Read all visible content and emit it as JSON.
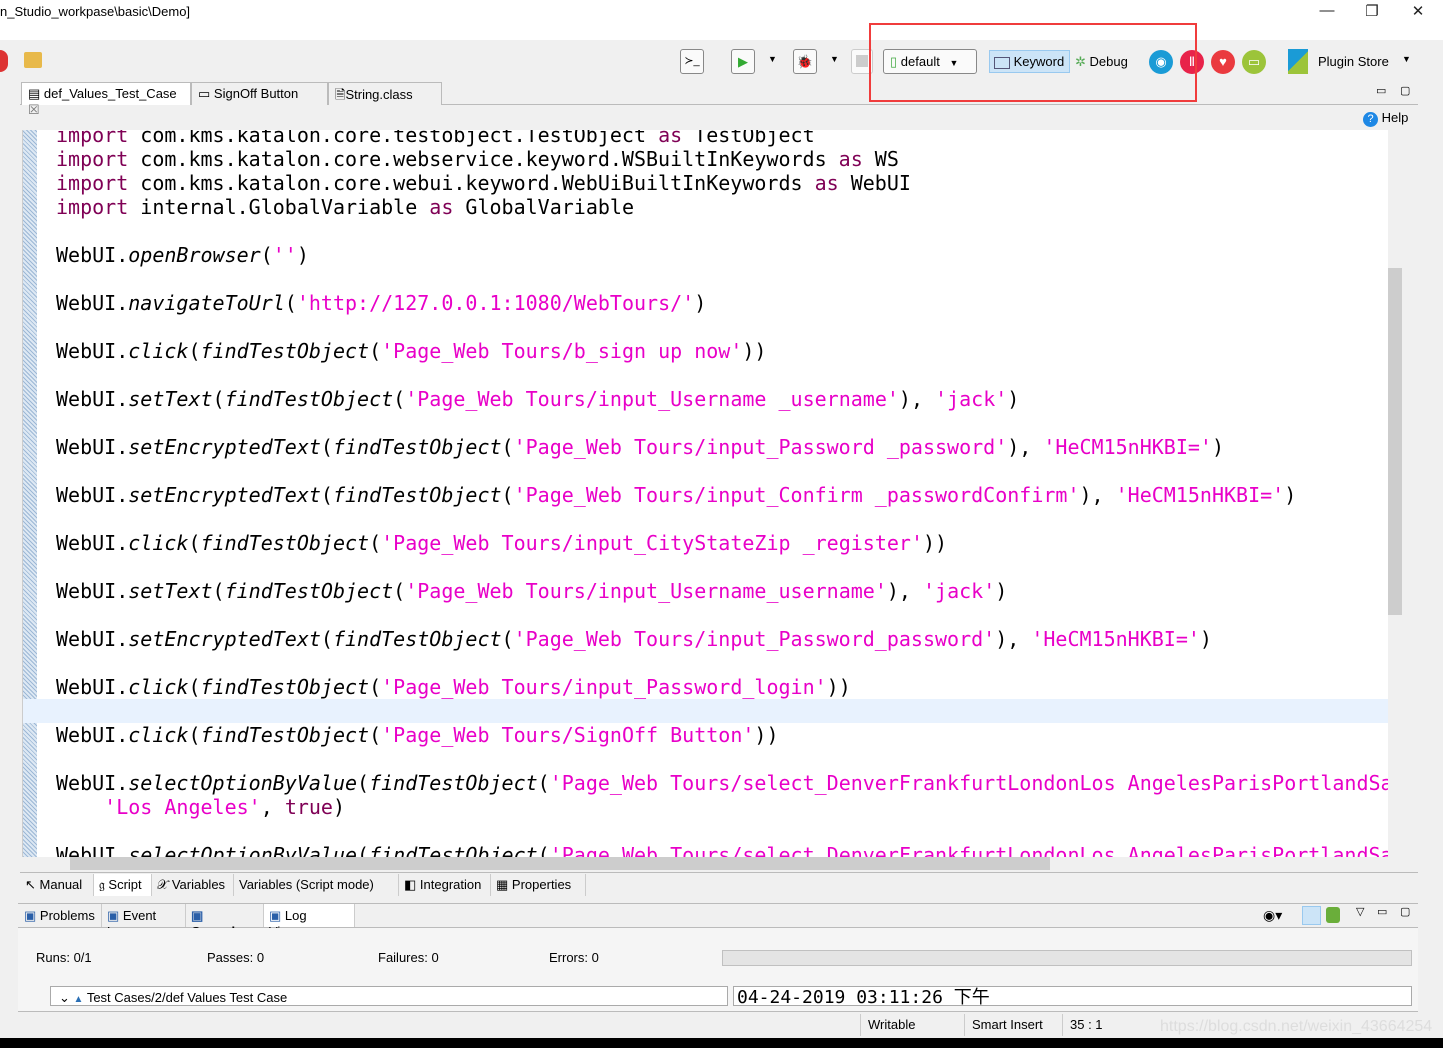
{
  "window": {
    "title": "n_Studio_workpase\\basic\\Demo]",
    "minimize": "—",
    "restore": "❐",
    "close": "✕"
  },
  "toolbar": {
    "terminal": "≻_",
    "run": "▶",
    "debug_run": "🐞",
    "profile": "default",
    "profile_arrow": "▼",
    "keyword": "Keyword",
    "debug": "Debug",
    "plugin_store": "Plugin Store",
    "arrow": "▼"
  },
  "editor_tabs": [
    {
      "label": "def_Values_Test_Case",
      "close": "☒"
    },
    {
      "label": "SignOff Button"
    },
    {
      "label": "String.class"
    }
  ],
  "help": "Help",
  "colors": {
    "keyword": "#7f0055",
    "string": "#e800c8",
    "highlight_box": "#f03c3c"
  },
  "editor": {
    "lines": [
      {
        "tokens": [
          {
            "t": "import",
            "c": "kw"
          },
          {
            "t": " com.kms.katalon.core.testobject.TestObject "
          },
          {
            "t": "as",
            "c": "kw"
          },
          {
            "t": " TestObject"
          }
        ]
      },
      {
        "tokens": [
          {
            "t": "import",
            "c": "kw"
          },
          {
            "t": " com.kms.katalon.core.webservice.keyword.WSBuiltInKeywords "
          },
          {
            "t": "as",
            "c": "kw"
          },
          {
            "t": " WS"
          }
        ]
      },
      {
        "tokens": [
          {
            "t": "import",
            "c": "kw"
          },
          {
            "t": " com.kms.katalon.core.webui.keyword.WebUiBuiltInKeywords "
          },
          {
            "t": "as",
            "c": "kw"
          },
          {
            "t": " WebUI"
          }
        ]
      },
      {
        "tokens": [
          {
            "t": "import",
            "c": "kw"
          },
          {
            "t": " internal.GlobalVariable "
          },
          {
            "t": "as",
            "c": "kw"
          },
          {
            "t": " GlobalVariable"
          }
        ]
      },
      {
        "tokens": []
      },
      {
        "tokens": [
          {
            "t": "WebUI."
          },
          {
            "t": "openBrowser",
            "c": "it"
          },
          {
            "t": "("
          },
          {
            "t": "''",
            "c": "str"
          },
          {
            "t": ")"
          }
        ]
      },
      {
        "tokens": []
      },
      {
        "tokens": [
          {
            "t": "WebUI."
          },
          {
            "t": "navigateToUrl",
            "c": "it"
          },
          {
            "t": "("
          },
          {
            "t": "'http://127.0.0.1:1080/WebTours/'",
            "c": "str"
          },
          {
            "t": ")"
          }
        ]
      },
      {
        "tokens": []
      },
      {
        "tokens": [
          {
            "t": "WebUI."
          },
          {
            "t": "click",
            "c": "it"
          },
          {
            "t": "("
          },
          {
            "t": "findTestObject",
            "c": "it"
          },
          {
            "t": "("
          },
          {
            "t": "'Page_Web Tours/b_sign up now'",
            "c": "str"
          },
          {
            "t": "))"
          }
        ]
      },
      {
        "tokens": []
      },
      {
        "tokens": [
          {
            "t": "WebUI."
          },
          {
            "t": "setText",
            "c": "it"
          },
          {
            "t": "("
          },
          {
            "t": "findTestObject",
            "c": "it"
          },
          {
            "t": "("
          },
          {
            "t": "'Page_Web Tours/input_Username _username'",
            "c": "str"
          },
          {
            "t": "), "
          },
          {
            "t": "'jack'",
            "c": "str"
          },
          {
            "t": ")"
          }
        ]
      },
      {
        "tokens": []
      },
      {
        "tokens": [
          {
            "t": "WebUI."
          },
          {
            "t": "setEncryptedText",
            "c": "it"
          },
          {
            "t": "("
          },
          {
            "t": "findTestObject",
            "c": "it"
          },
          {
            "t": "("
          },
          {
            "t": "'Page_Web Tours/input_Password _password'",
            "c": "str"
          },
          {
            "t": "), "
          },
          {
            "t": "'HeCM15nHKBI='",
            "c": "str"
          },
          {
            "t": ")"
          }
        ]
      },
      {
        "tokens": []
      },
      {
        "tokens": [
          {
            "t": "WebUI."
          },
          {
            "t": "setEncryptedText",
            "c": "it"
          },
          {
            "t": "("
          },
          {
            "t": "findTestObject",
            "c": "it"
          },
          {
            "t": "("
          },
          {
            "t": "'Page_Web Tours/input_Confirm _passwordConfirm'",
            "c": "str"
          },
          {
            "t": "), "
          },
          {
            "t": "'HeCM15nHKBI='",
            "c": "str"
          },
          {
            "t": ")"
          }
        ]
      },
      {
        "tokens": []
      },
      {
        "tokens": [
          {
            "t": "WebUI."
          },
          {
            "t": "click",
            "c": "it"
          },
          {
            "t": "("
          },
          {
            "t": "findTestObject",
            "c": "it"
          },
          {
            "t": "("
          },
          {
            "t": "'Page_Web Tours/input_CityStateZip _register'",
            "c": "str"
          },
          {
            "t": "))"
          }
        ]
      },
      {
        "tokens": []
      },
      {
        "tokens": [
          {
            "t": "WebUI."
          },
          {
            "t": "setText",
            "c": "it"
          },
          {
            "t": "("
          },
          {
            "t": "findTestObject",
            "c": "it"
          },
          {
            "t": "("
          },
          {
            "t": "'Page_Web Tours/input_Username_username'",
            "c": "str"
          },
          {
            "t": "), "
          },
          {
            "t": "'jack'",
            "c": "str"
          },
          {
            "t": ")"
          }
        ]
      },
      {
        "tokens": []
      },
      {
        "tokens": [
          {
            "t": "WebUI."
          },
          {
            "t": "setEncryptedText",
            "c": "it"
          },
          {
            "t": "("
          },
          {
            "t": "findTestObject",
            "c": "it"
          },
          {
            "t": "("
          },
          {
            "t": "'Page_Web Tours/input_Password_password'",
            "c": "str"
          },
          {
            "t": "), "
          },
          {
            "t": "'HeCM15nHKBI='",
            "c": "str"
          },
          {
            "t": ")"
          }
        ]
      },
      {
        "tokens": []
      },
      {
        "tokens": [
          {
            "t": "WebUI."
          },
          {
            "t": "click",
            "c": "it"
          },
          {
            "t": "("
          },
          {
            "t": "findTestObject",
            "c": "it"
          },
          {
            "t": "("
          },
          {
            "t": "'Page_Web Tours/input_Password_login'",
            "c": "str"
          },
          {
            "t": "))"
          }
        ]
      },
      {
        "tokens": [],
        "highlight": true
      },
      {
        "tokens": [
          {
            "t": "WebUI."
          },
          {
            "t": "click",
            "c": "it"
          },
          {
            "t": "("
          },
          {
            "t": "findTestObject",
            "c": "it"
          },
          {
            "t": "("
          },
          {
            "t": "'Page_Web Tours/SignOff Button'",
            "c": "str"
          },
          {
            "t": "))"
          }
        ]
      },
      {
        "tokens": []
      },
      {
        "tokens": [
          {
            "t": "WebUI."
          },
          {
            "t": "selectOptionByValue",
            "c": "it"
          },
          {
            "t": "("
          },
          {
            "t": "findTestObject",
            "c": "it"
          },
          {
            "t": "("
          },
          {
            "t": "'Page_Web Tours/select_DenverFrankfurtLondonLos AngelesParisPortlandSa",
            "c": "str"
          }
        ]
      },
      {
        "tokens": [
          {
            "t": "    "
          },
          {
            "t": "'Los Angeles'",
            "c": "str"
          },
          {
            "t": ", "
          },
          {
            "t": "true",
            "c": "kw"
          },
          {
            "t": ")"
          }
        ]
      },
      {
        "tokens": []
      },
      {
        "tokens": [
          {
            "t": "WebUI."
          },
          {
            "t": "selectOptionByValue",
            "c": "it"
          },
          {
            "t": "("
          },
          {
            "t": "findTestObject",
            "c": "it"
          },
          {
            "t": "("
          },
          {
            "t": "'Page_Web Tours/select_DenverFrankfurtLondonLos AngelesParisPortlandSa",
            "c": "str"
          }
        ]
      }
    ]
  },
  "mode_tabs": [
    "Manual",
    "Script",
    "Variables",
    "Variables (Script mode)",
    "Integration",
    "Properties"
  ],
  "panel_tabs": [
    "Problems",
    "Event Log",
    "Console",
    "Log Viewer"
  ],
  "log": {
    "runs": "Runs: 0/1",
    "passes": "Passes: 0",
    "failures": "Failures: 0",
    "errors": "Errors: 0",
    "progress": 0,
    "tree_item": "Test Cases/2/def Values Test Case",
    "timestamp": "04-24-2019 03:11:26 下午"
  },
  "statusbar": {
    "writable": "Writable",
    "insert": "Smart Insert",
    "position": "35 : 1",
    "watermark": "https://blog.csdn.net/weixin_43664254"
  }
}
